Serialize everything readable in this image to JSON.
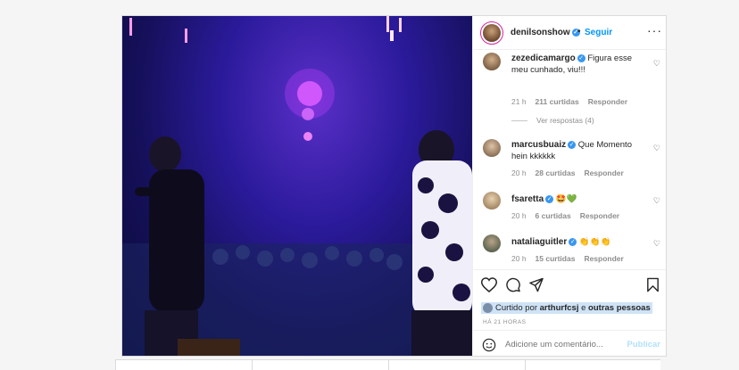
{
  "header": {
    "username": "denilsonshow",
    "separator": "•",
    "follow_label": "Seguir",
    "more_label": "•••"
  },
  "comments": [
    {
      "username": "zezedicamargo",
      "verified": true,
      "text": "Figura esse meu cunhado, viu!!!",
      "time": "21 h",
      "likes": "211 curtidas",
      "reply": "Responder",
      "view_replies": "Ver respostas (4)"
    },
    {
      "username": "marcusbuaiz",
      "verified": true,
      "text": "Que Momento hein kkkkkk",
      "time": "20 h",
      "likes": "28 curtidas",
      "reply": "Responder"
    },
    {
      "username": "fsaretta",
      "verified": true,
      "text": "🤩💚",
      "time": "20 h",
      "likes": "6 curtidas",
      "reply": "Responder"
    },
    {
      "username": "nataliaguitler",
      "verified": true,
      "text": "👏👏👏",
      "time": "20 h",
      "likes": "15 curtidas",
      "reply": "Responder"
    }
  ],
  "likes_line": {
    "prefix": "Curtido por",
    "user": "arthurfcsj",
    "joiner": "e",
    "others": "outras pessoas"
  },
  "timestamp": "HÁ 21 HORAS",
  "add_comment": {
    "placeholder": "Adicione um comentário...",
    "publish_label": "Publicar"
  },
  "icons": [
    "heart-icon",
    "comment-icon",
    "share-icon",
    "bookmark-icon",
    "emoji-icon"
  ],
  "colors": {
    "accent": "#0095f6",
    "verified": "#3897f0",
    "stage": "#2a1a9a"
  }
}
